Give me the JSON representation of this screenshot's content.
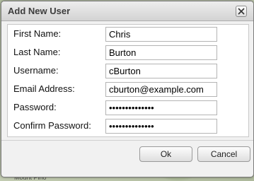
{
  "dialog": {
    "title": "Add New User",
    "close_icon": "close-icon"
  },
  "form": {
    "first_name": {
      "label": "First Name:",
      "value": "Chris"
    },
    "last_name": {
      "label": "Last Name:",
      "value": "Burton"
    },
    "username": {
      "label": "Username:",
      "value": "cBurton"
    },
    "email": {
      "label": "Email Address:",
      "value": "cburton@example.com"
    },
    "password": {
      "label": "Password:",
      "value": "••••••••••••••"
    },
    "confirm_password": {
      "label": "Confirm Password:",
      "value": "••••••••••••••"
    }
  },
  "buttons": {
    "ok": "Ok",
    "cancel": "Cancel"
  },
  "background_map": {
    "snippets": [
      "Mount Pino"
    ]
  }
}
